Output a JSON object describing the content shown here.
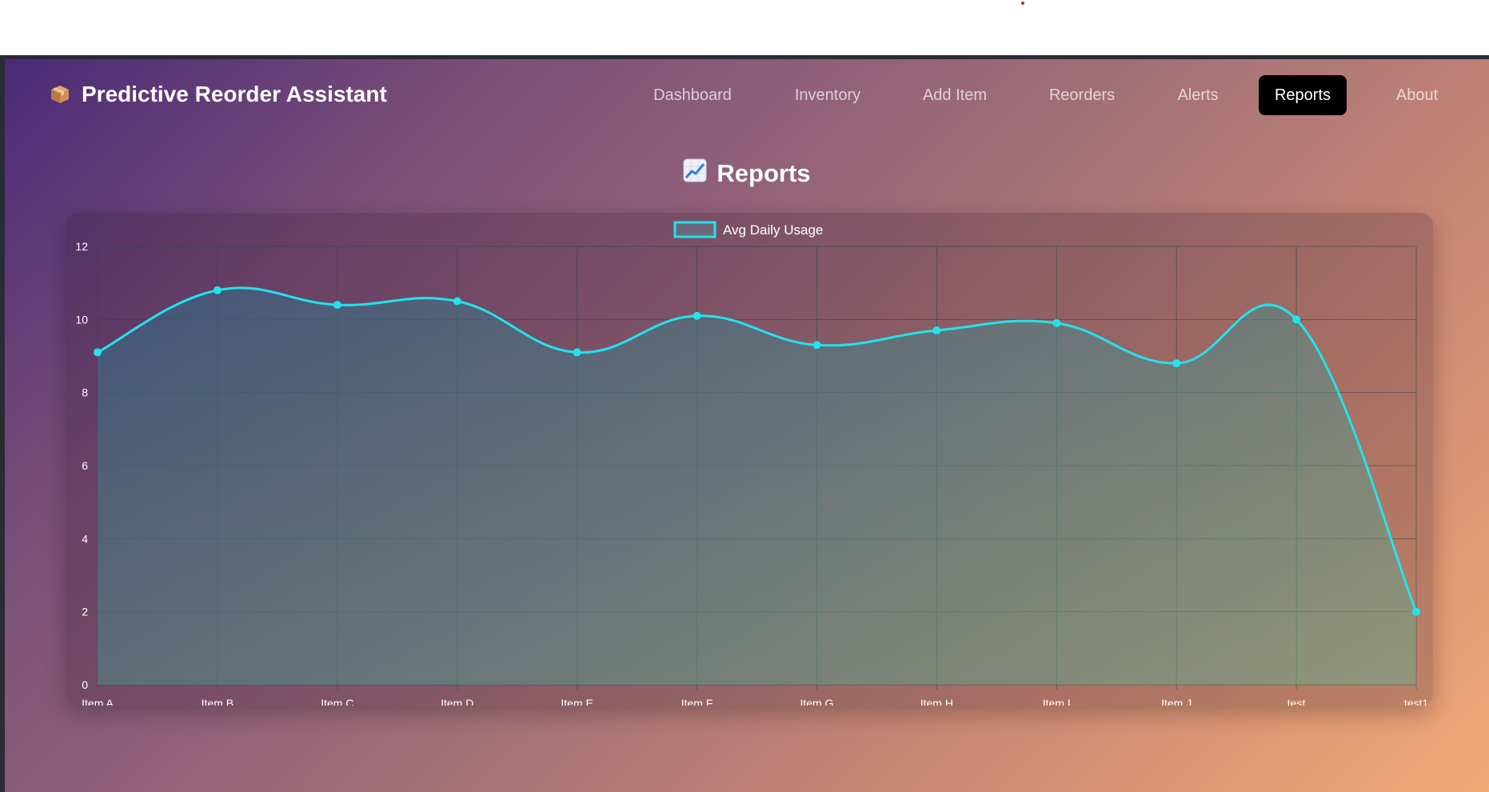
{
  "app": {
    "title": "Predictive Reorder Assistant",
    "logo_icon": "package-icon"
  },
  "nav": {
    "items": [
      {
        "label": "Dashboard",
        "active": false
      },
      {
        "label": "Inventory",
        "active": false
      },
      {
        "label": "Add Item",
        "active": false
      },
      {
        "label": "Reorders",
        "active": false
      },
      {
        "label": "Alerts",
        "active": false
      },
      {
        "label": "Reports",
        "active": true
      },
      {
        "label": "About",
        "active": false
      }
    ]
  },
  "page": {
    "title": "Reports",
    "title_icon": "chart-increasing-icon"
  },
  "colors": {
    "accent": "#22e3ee",
    "active_nav_bg": "#000000",
    "text": "#ffffff"
  },
  "chart_data": {
    "type": "line",
    "categories": [
      "Item A",
      "Item B",
      "Item C",
      "Item D",
      "Item E",
      "Item F",
      "Item G",
      "Item H",
      "Item I",
      "Item J",
      "test",
      "test1"
    ],
    "series": [
      {
        "name": "Avg Daily Usage",
        "values": [
          9.1,
          10.8,
          10.4,
          10.5,
          9.1,
          10.1,
          9.3,
          9.7,
          9.9,
          8.8,
          10.0,
          2.0
        ]
      }
    ],
    "ylim": [
      0,
      12
    ],
    "yticks": [
      0,
      2,
      4,
      6,
      8,
      10,
      12
    ],
    "fill": true,
    "smooth": true,
    "grid": true,
    "legend_position": "top-center",
    "title": "",
    "xlabel": "",
    "ylabel": ""
  }
}
